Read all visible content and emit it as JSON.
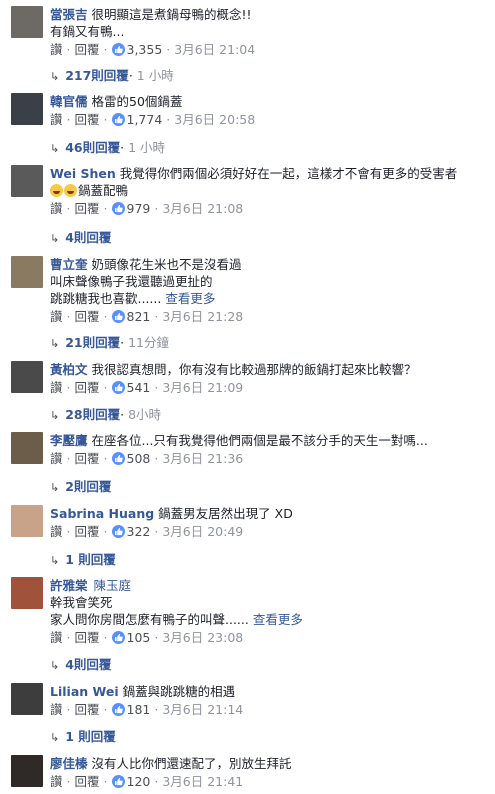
{
  "labels": {
    "like": "讚",
    "reply": "回覆",
    "dot": "·",
    "see_more": "查看更多",
    "reply_arrow": "↳"
  },
  "comments": [
    {
      "author": "當張吉",
      "lines": [
        "很明顯這是煮鍋母鴨的概念!!",
        "有鍋又有鴨..."
      ],
      "likes": "3,355",
      "date": "3月6日 21:04",
      "replies": "217則回覆",
      "reply_time": "1 小時",
      "avatar_color": "#6d6a66"
    },
    {
      "author": "韓官儒",
      "lines": [
        "格雷的50個鍋蓋"
      ],
      "likes": "1,774",
      "date": "3月6日 20:58",
      "replies": "46則回覆",
      "reply_time": "1 小時",
      "avatar_color": "#3a3f48"
    },
    {
      "author": "Wei Shen",
      "lines": [
        "我覺得你們兩個必須好好在一起，這樣才不會有更多的受害者",
        "鍋蓋配鴨"
      ],
      "likes": "979",
      "date": "3月6日 21:08",
      "replies": "4則回覆",
      "reply_time": "",
      "avatar_color": "#5a5a5a"
    },
    {
      "author": "曹立奎",
      "lines": [
        "奶頭像花生米也不是沒看過",
        "叫床聲像鴨子我還聽過更扯的",
        "跳跳糖我也喜歡......"
      ],
      "likes": "821",
      "date": "3月6日 21:28",
      "replies": "21則回覆",
      "reply_time": "11分鐘",
      "avatar_color": "#8a7a62"
    },
    {
      "author": "黃柏文",
      "lines": [
        "我很認真想問，你有沒有比較過那牌的飯鍋打起來比較響？"
      ],
      "likes": "541",
      "date": "3月6日 21:09",
      "replies": "28則回覆",
      "reply_time": "8小時",
      "avatar_color": "#4a4a4a"
    },
    {
      "author": "李壓鷹",
      "lines": [
        "在座各位...只有我覺得他們兩個是最不該分手的天生一對嗎..."
      ],
      "likes": "508",
      "date": "3月6日 21:36",
      "replies": "2則回覆",
      "reply_time": "",
      "avatar_color": "#6b5d4a"
    },
    {
      "author": "Sabrina Huang",
      "lines": [
        "鍋蓋男友居然出現了 XD"
      ],
      "likes": "322",
      "date": "3月6日 20:49",
      "replies": "1 則回覆",
      "reply_time": "",
      "avatar_color": "#c9a28a"
    },
    {
      "author": "許雅棠",
      "tag": "陳玉庭",
      "lines": [
        "幹我會笑死",
        "家人問你房間怎麼有鴨子的叫聲......"
      ],
      "likes": "105",
      "date": "3月6日 23:08",
      "replies": "4則回覆",
      "reply_time": "",
      "avatar_color": "#a0523a"
    },
    {
      "author": "Lilian Wei",
      "lines": [
        "鍋蓋與跳跳糖的相遇"
      ],
      "likes": "181",
      "date": "3月6日 21:14",
      "replies": "1 則回覆",
      "reply_time": "",
      "avatar_color": "#3d3d3d"
    },
    {
      "author": "廖佳榛",
      "lines": [
        "沒有人比你們還速配了，別放生拜託"
      ],
      "likes": "120",
      "date": "3月6日 21:41",
      "replies": "",
      "reply_time": "",
      "avatar_color": "#2f2a28"
    }
  ]
}
